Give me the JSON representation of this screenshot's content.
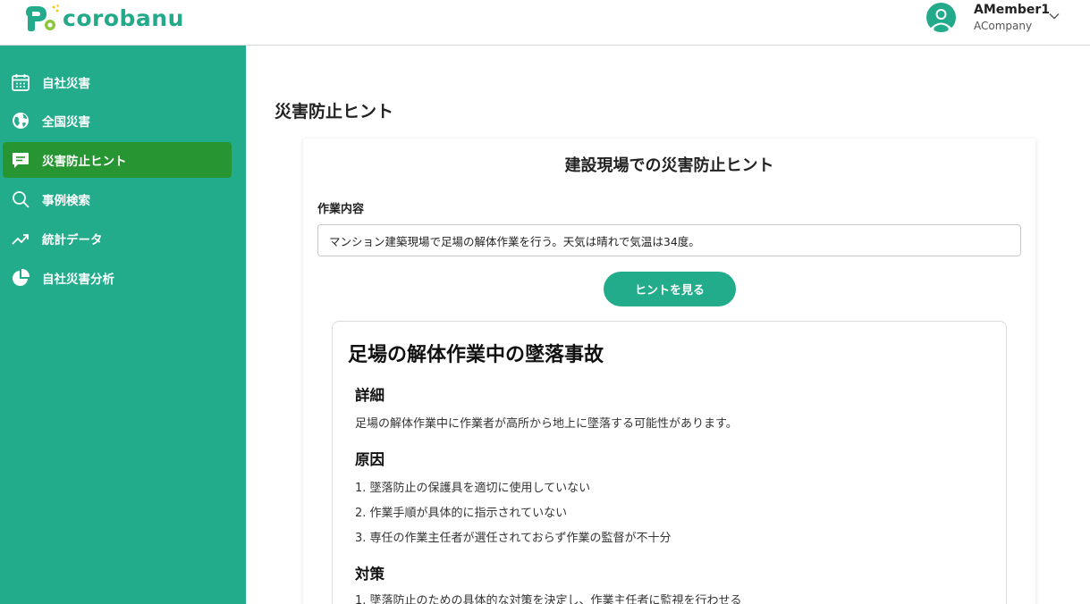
{
  "header": {
    "logo_text": "corobanu",
    "user_name": "AMember1",
    "user_company": "ACompany"
  },
  "sidebar": {
    "items": [
      {
        "label": "自社災害",
        "icon": "calendar-icon",
        "active": false
      },
      {
        "label": "全国災害",
        "icon": "globe-icon",
        "active": false
      },
      {
        "label": "災害防止ヒント",
        "icon": "chat-icon",
        "active": true
      },
      {
        "label": "事例検索",
        "icon": "search-icon",
        "active": false
      },
      {
        "label": "統計データ",
        "icon": "trending-icon",
        "active": false
      },
      {
        "label": "自社災害分析",
        "icon": "pie-chart-icon",
        "active": false
      }
    ]
  },
  "main": {
    "page_title": "災害防止ヒント",
    "card": {
      "title": "建設現場での災害防止ヒント",
      "field_label": "作業内容",
      "field_value": "マンション建築現場で足場の解体作業を行う。天気は晴れで気温は34度。",
      "button_label": "ヒントを見る"
    },
    "result": {
      "title": "足場の解体作業中の墜落事故",
      "details_heading": "詳細",
      "details_text": "足場の解体作業中に作業者が高所から地上に墜落する可能性があります。",
      "causes_heading": "原因",
      "causes": [
        "1. 墜落防止の保護具を適切に使用していない",
        "2. 作業手順が具体的に指示されていない",
        "3. 専任の作業主任者が選任されておらず作業の監督が不十分"
      ],
      "measures_heading": "対策",
      "measures": [
        "1. 墜落防止のための具体的な対策を決定し、作業主任者に監視を行わせる"
      ]
    }
  },
  "colors": {
    "brand": "#23ac8b",
    "active": "#279632"
  }
}
